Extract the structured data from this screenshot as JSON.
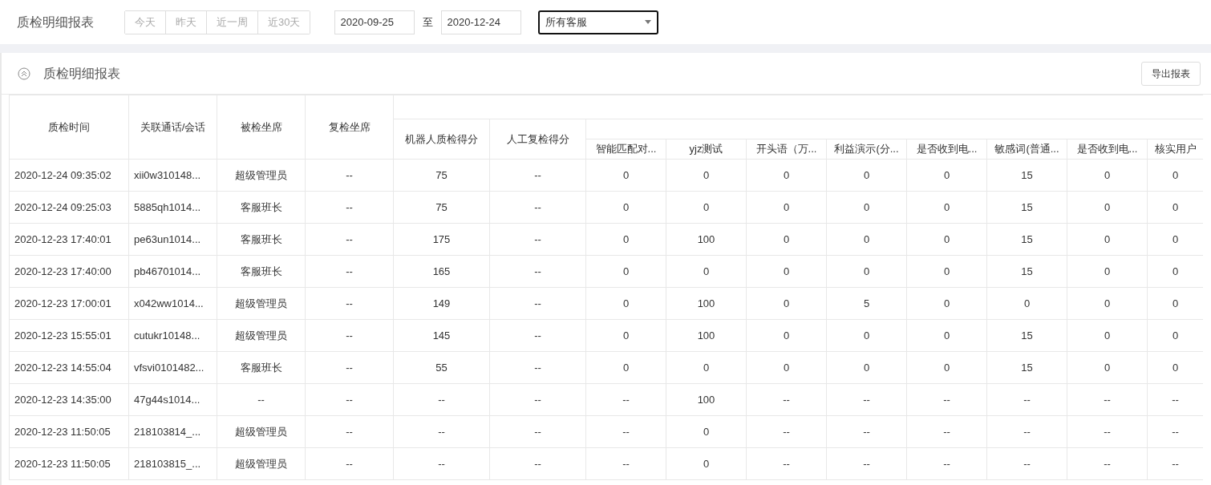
{
  "toolbar": {
    "title": "质检明细报表",
    "quick_ranges": [
      {
        "label": "今天",
        "selected": false
      },
      {
        "label": "昨天",
        "selected": false
      },
      {
        "label": "近一周",
        "selected": false
      },
      {
        "label": "近30天",
        "selected": false
      }
    ],
    "date_from": "2020-09-25",
    "date_separator": "至",
    "date_to": "2020-12-24",
    "agent_select": "所有客服"
  },
  "panel": {
    "title": "质检明细报表",
    "export_button": "导出报表"
  },
  "table": {
    "columns": [
      "质检时间",
      "关联通话/会话",
      "被检坐席",
      "复检坐席",
      "机器人质检得分",
      "人工复检得分",
      "智能匹配对...",
      "yjz测试",
      "开头语（万...",
      "利益演示(分...",
      "是否收到电...",
      "敏感词(普通...",
      "是否收到电...",
      "核实用户"
    ],
    "rows": [
      [
        "2020-12-24 09:35:02",
        "xii0w310148...",
        "超级管理员",
        "--",
        "75",
        "--",
        "0",
        "0",
        "0",
        "0",
        "0",
        "15",
        "0",
        "0"
      ],
      [
        "2020-12-24 09:25:03",
        "5885qh1014...",
        "客服班长",
        "--",
        "75",
        "--",
        "0",
        "0",
        "0",
        "0",
        "0",
        "15",
        "0",
        "0"
      ],
      [
        "2020-12-23 17:40:01",
        "pe63un1014...",
        "客服班长",
        "--",
        "175",
        "--",
        "0",
        "100",
        "0",
        "0",
        "0",
        "15",
        "0",
        "0"
      ],
      [
        "2020-12-23 17:40:00",
        "pb46701014...",
        "客服班长",
        "--",
        "165",
        "--",
        "0",
        "0",
        "0",
        "0",
        "0",
        "15",
        "0",
        "0"
      ],
      [
        "2020-12-23 17:00:01",
        "x042ww1014...",
        "超级管理员",
        "--",
        "149",
        "--",
        "0",
        "100",
        "0",
        "5",
        "0",
        "0",
        "0",
        "0"
      ],
      [
        "2020-12-23 15:55:01",
        "cutukr10148...",
        "超级管理员",
        "--",
        "145",
        "--",
        "0",
        "100",
        "0",
        "0",
        "0",
        "15",
        "0",
        "0"
      ],
      [
        "2020-12-23 14:55:04",
        "vfsvi0101482...",
        "客服班长",
        "--",
        "55",
        "--",
        "0",
        "0",
        "0",
        "0",
        "0",
        "15",
        "0",
        "0"
      ],
      [
        "2020-12-23 14:35:00",
        "47g44s1014...",
        "--",
        "--",
        "--",
        "--",
        "--",
        "100",
        "--",
        "--",
        "--",
        "--",
        "--",
        "--"
      ],
      [
        "2020-12-23 11:50:05",
        "218103814_...",
        "超级管理员",
        "--",
        "--",
        "--",
        "--",
        "0",
        "--",
        "--",
        "--",
        "--",
        "--",
        "--"
      ],
      [
        "2020-12-23 11:50:05",
        "218103815_...",
        "超级管理员",
        "--",
        "--",
        "--",
        "--",
        "0",
        "--",
        "--",
        "--",
        "--",
        "--",
        "--"
      ]
    ]
  }
}
